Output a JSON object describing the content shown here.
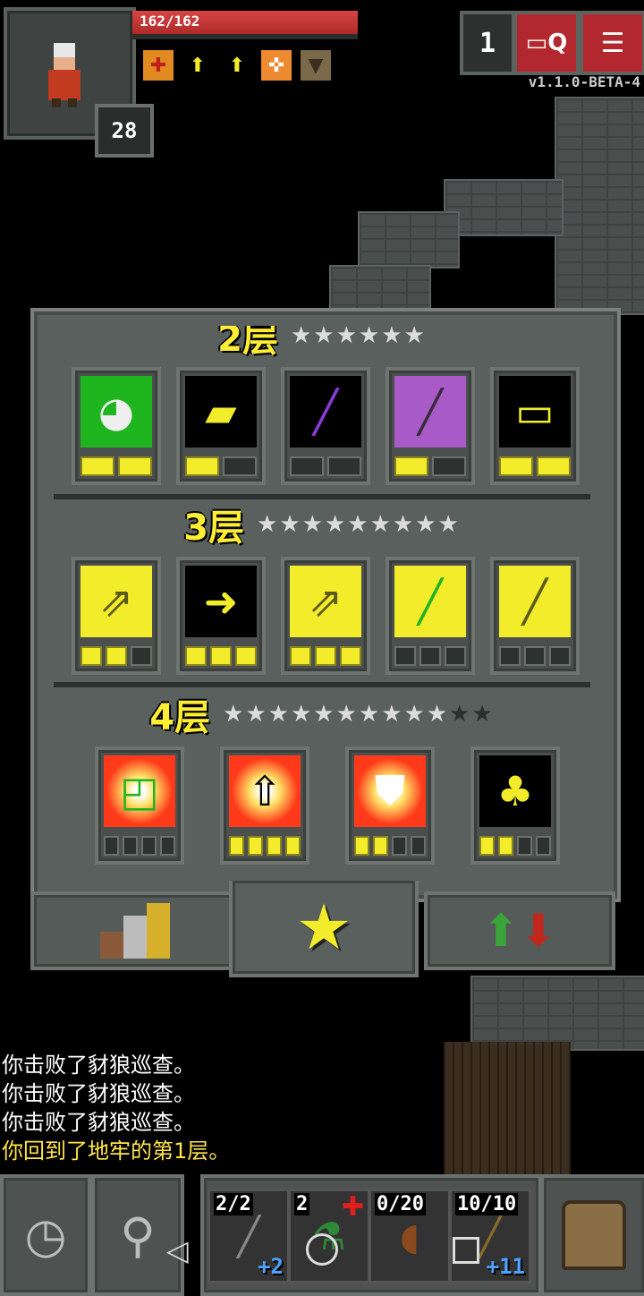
{
  "hud": {
    "hp_text": "162/162",
    "hp_fraction": 1.0,
    "level": "28",
    "depth": "1",
    "version": "v1.1.0-BETA-4",
    "buffs": [
      "red-plus-icon",
      "yellow-arrow-icon",
      "yellow-arrow-icon",
      "orange-cross-icon",
      "brown-bucket-icon"
    ],
    "journal_icon": "journal-icon",
    "menu_icon": "menu-icon"
  },
  "talents": {
    "tier2": {
      "label": "2层",
      "stars": "★★★★★★"
    },
    "tier3": {
      "label": "3层",
      "stars_on": "★★★★★★★★★",
      "stars_off": ""
    },
    "tier4": {
      "label": "4层",
      "stars_on": "★★★★★★★★★★",
      "stars_off": "★★"
    }
  },
  "tabs": {
    "stats_icon": "stats-icon",
    "talents_icon": "star-icon",
    "swap_icon": "swap-arrows-icon"
  },
  "log": [
    "你击败了豺狼巡查。",
    "你击败了豺狼巡查。",
    "你击败了豺狼巡查。",
    "你回到了地牢的第1层。"
  ],
  "toolbar": {
    "wait_icon": "clock-icon",
    "search_icon": "magnifier-icon",
    "slot1": {
      "top": "2/2",
      "bottom": "+2"
    },
    "slot2": {
      "top": "2"
    },
    "slot3": {
      "top": "0/20"
    },
    "slot4": {
      "top": "10/10",
      "bottom": "+11"
    },
    "backpack_icon": "backpack-icon"
  }
}
